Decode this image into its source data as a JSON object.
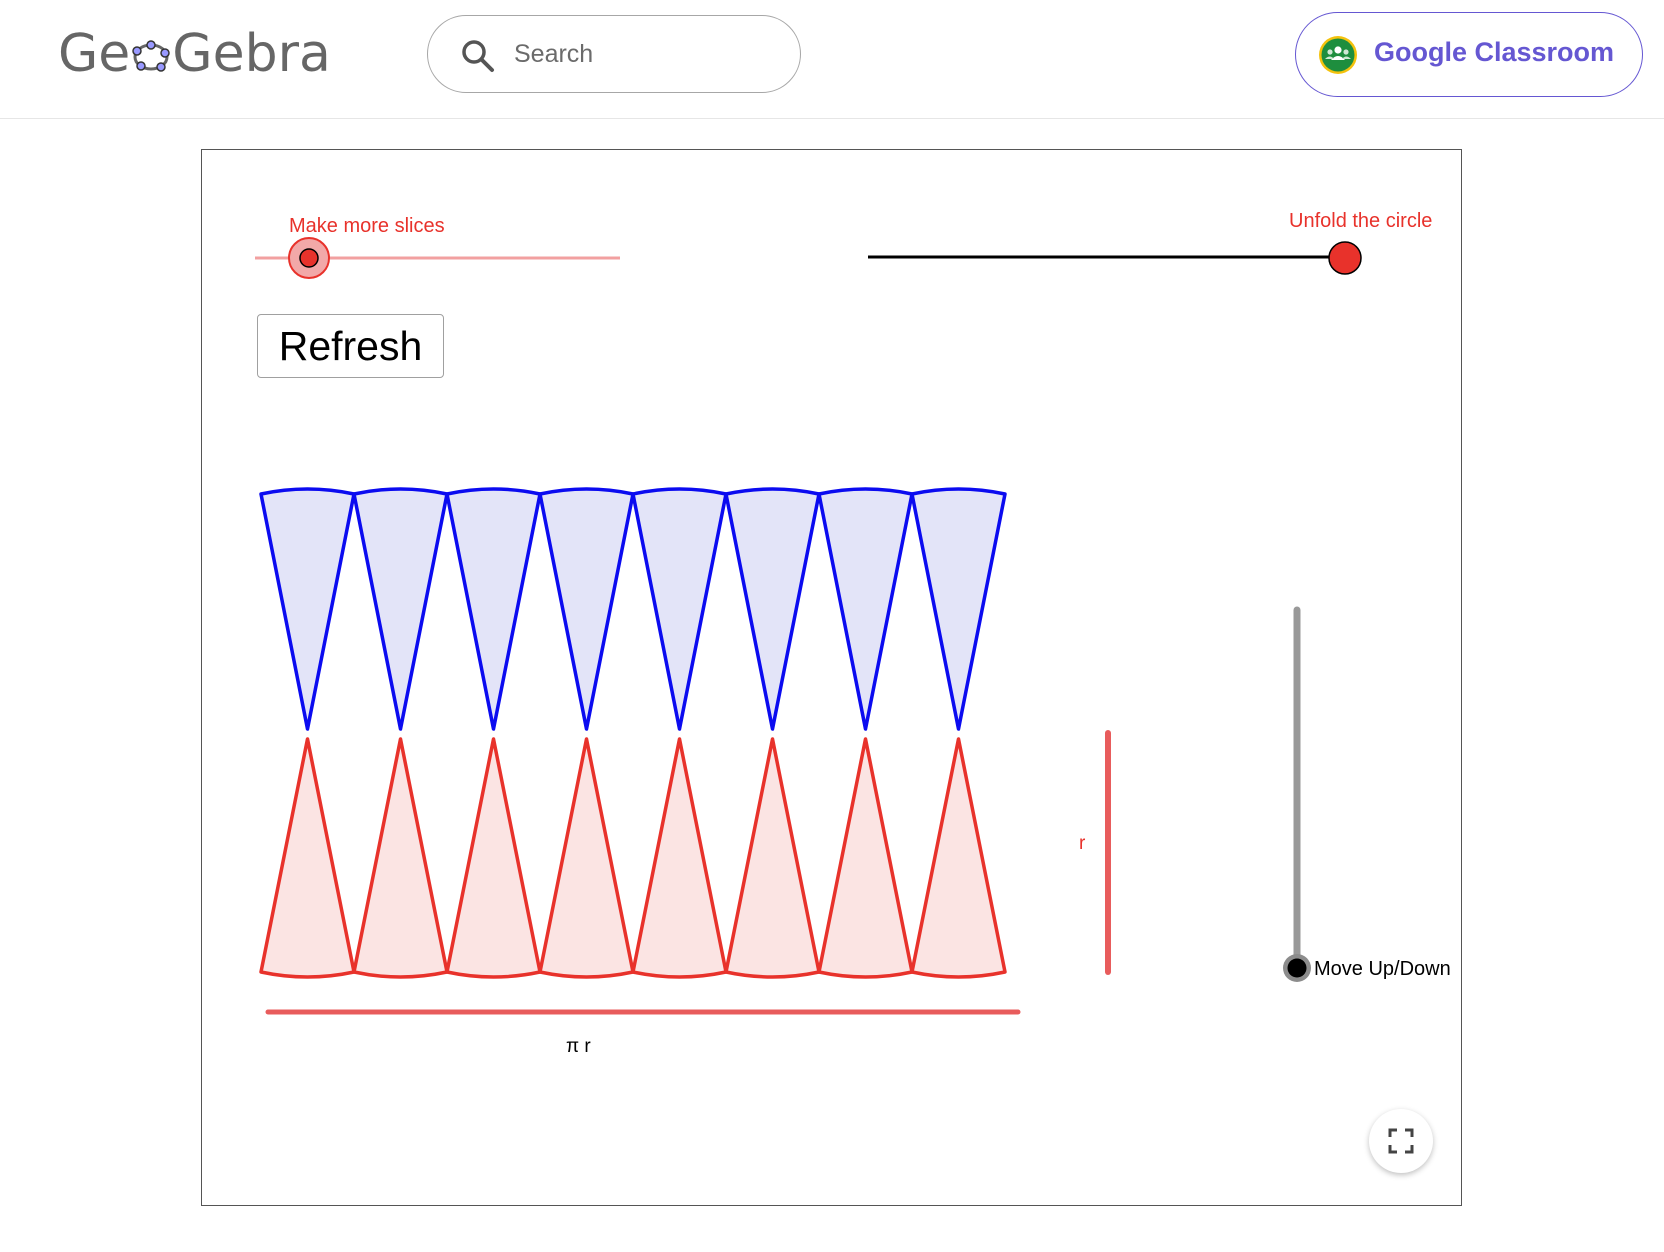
{
  "header": {
    "logo": {
      "prefix": "Ge",
      "suffix": "Gebra"
    },
    "search": {
      "placeholder": "Search"
    },
    "classroom_button": {
      "label": "Google Classroom"
    }
  },
  "applet": {
    "slices_slider": {
      "label": "Make more slices",
      "value_fraction": 0.15
    },
    "unfold_slider": {
      "label": "Unfold the circle",
      "value_fraction": 1.0
    },
    "refresh_button": {
      "label": "Refresh"
    },
    "move_slider": {
      "label": "Move Up/Down",
      "value_fraction": 0.0
    },
    "radius_label": "r",
    "half_circumference_label": "π r",
    "slice_count_per_row": 8,
    "colors": {
      "blue_stroke": "#0b0bf0",
      "blue_fill": "#e3e4f8",
      "red_stroke": "#e8322b",
      "red_fill": "#fbe4e3",
      "slider_red": "#e8322b",
      "segment_red": "#e85c5c",
      "slider_gray": "#999999",
      "accent_purple": "#6557d2"
    }
  }
}
